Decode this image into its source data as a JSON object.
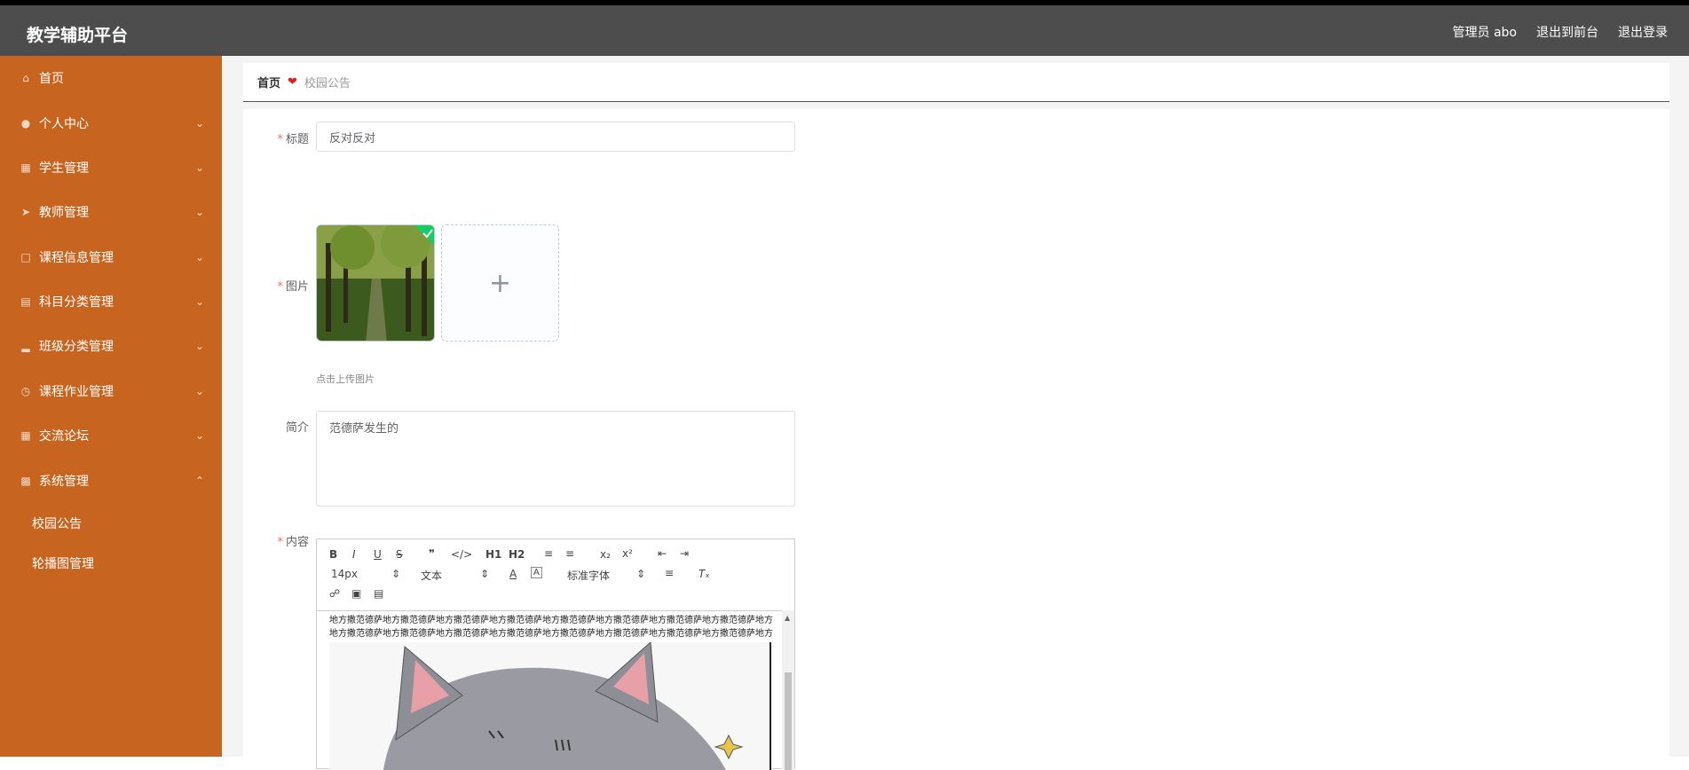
{
  "header": {
    "title": "教学辅助平台",
    "admin_label": "管理员 abo",
    "front_link": "退出到前台",
    "logout_link": "退出登录"
  },
  "sidebar": {
    "items": [
      {
        "label": "首页",
        "icon": "home-icon"
      },
      {
        "label": "个人中心",
        "icon": "user-icon"
      },
      {
        "label": "学生管理",
        "icon": "clipboard-icon"
      },
      {
        "label": "教师管理",
        "icon": "send-icon"
      },
      {
        "label": "课程信息管理",
        "icon": "square-icon"
      },
      {
        "label": "科目分类管理",
        "icon": "card-icon"
      },
      {
        "label": "班级分类管理",
        "icon": "bar-chart-icon"
      },
      {
        "label": "课程作业管理",
        "icon": "clock-icon"
      },
      {
        "label": "交流论坛",
        "icon": "grid-icon"
      },
      {
        "label": "系统管理",
        "icon": "building-icon"
      }
    ],
    "sub_items": [
      "校园公告",
      "轮播图管理"
    ]
  },
  "breadcrumb": {
    "home": "首页",
    "current": "校园公告"
  },
  "form": {
    "title_label": "标题",
    "title_value": "反对反对",
    "image_label": "图片",
    "upload_hint": "点击上传图片",
    "intro_label": "简介",
    "intro_value": "范德萨发生的",
    "content_label": "内容",
    "required_mark": "*",
    "plus": "+"
  },
  "editor": {
    "font_size": "14px",
    "block_type": "文本",
    "font_family": "标准字体",
    "content_line": "地方撒范德萨地方撒范德萨地方撒范德萨地方撒范德萨地方撒范德萨地方撒范德萨地方撒范德萨地方撒范德萨地方撒范德萨地方撒范德萨"
  }
}
